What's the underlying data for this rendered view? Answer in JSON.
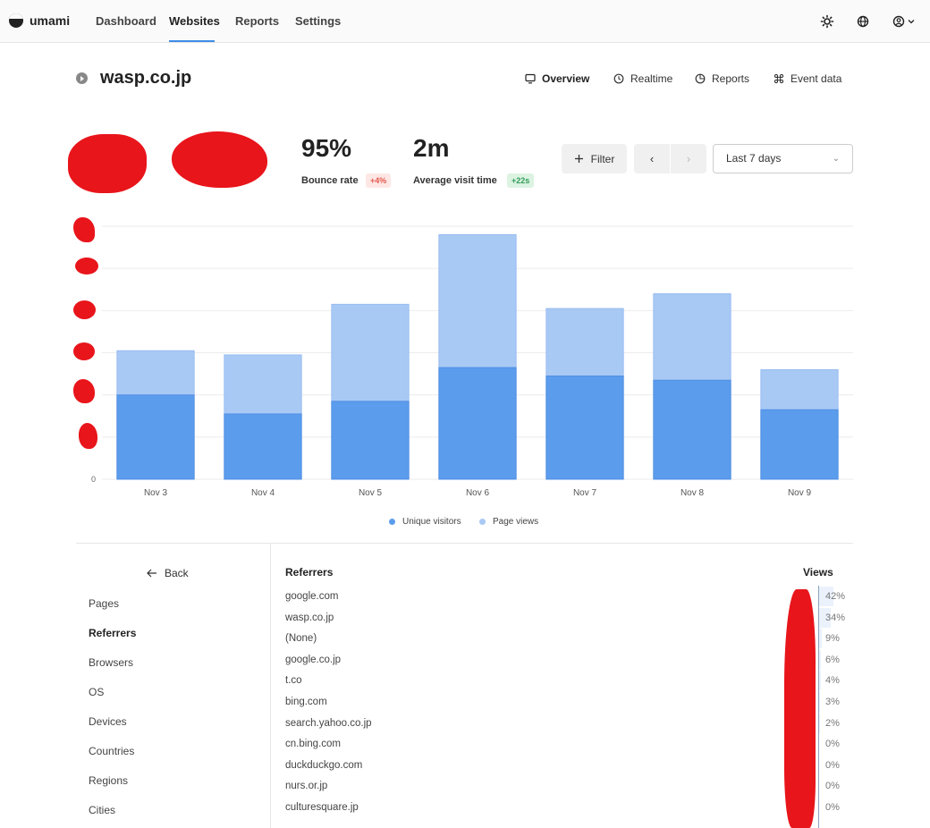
{
  "app": {
    "name": "umami"
  },
  "nav": {
    "items": [
      {
        "label": "Dashboard",
        "active": false
      },
      {
        "label": "Websites",
        "active": true
      },
      {
        "label": "Reports",
        "active": false
      },
      {
        "label": "Settings",
        "active": false
      }
    ]
  },
  "site": {
    "title": "wasp.co.jp"
  },
  "tabs": [
    {
      "label": "Overview",
      "icon": "monitor-icon",
      "active": true
    },
    {
      "label": "Realtime",
      "icon": "clock-icon",
      "active": false
    },
    {
      "label": "Reports",
      "icon": "reports-icon",
      "active": false
    },
    {
      "label": "Event data",
      "icon": "event-data-icon",
      "active": false
    }
  ],
  "metrics": {
    "bounce": {
      "value": "95%",
      "label": "Bounce rate",
      "change": "+4%"
    },
    "visit_time": {
      "value": "2m",
      "label": "Average visit time",
      "change": "+22s"
    }
  },
  "filter": {
    "label": "Filter"
  },
  "date_range": {
    "value": "Last 7 days"
  },
  "colors": {
    "unique": "#5b9cec",
    "views": "#a9c9f5",
    "accent": "#3e8ee8"
  },
  "chart_data": {
    "type": "bar",
    "categories": [
      "Nov 3",
      "Nov 4",
      "Nov 5",
      "Nov 6",
      "Nov 7",
      "Nov 8",
      "Nov 9"
    ],
    "series": [
      {
        "name": "Unique visitors",
        "values": [
          20,
          15.5,
          18.5,
          26.5,
          24.5,
          23.5,
          16.5
        ]
      },
      {
        "name": "Page views",
        "values": [
          30.5,
          29.5,
          41.5,
          58,
          40.5,
          44,
          26
        ]
      }
    ],
    "stacked": "overlay",
    "ylim": [
      0,
      60
    ],
    "y_tick_labels": [
      "0"
    ],
    "grid": true,
    "legend": "bottom-center"
  },
  "side_menu": {
    "back": "Back",
    "items": [
      {
        "label": "Pages",
        "active": false
      },
      {
        "label": "Referrers",
        "active": true
      },
      {
        "label": "Browsers",
        "active": false
      },
      {
        "label": "OS",
        "active": false
      },
      {
        "label": "Devices",
        "active": false
      },
      {
        "label": "Countries",
        "active": false
      },
      {
        "label": "Regions",
        "active": false
      },
      {
        "label": "Cities",
        "active": false
      }
    ]
  },
  "table": {
    "col_referrers": "Referrers",
    "col_views": "Views",
    "rows": [
      {
        "name": "google.com",
        "pct": "42%",
        "share": 0.42
      },
      {
        "name": "wasp.co.jp",
        "pct": "34%",
        "share": 0.34
      },
      {
        "name": "(None)",
        "pct": "9%",
        "share": 0.09
      },
      {
        "name": "google.co.jp",
        "pct": "6%",
        "share": 0.06
      },
      {
        "name": "t.co",
        "pct": "4%",
        "share": 0.04
      },
      {
        "name": "bing.com",
        "pct": "3%",
        "share": 0.03
      },
      {
        "name": "search.yahoo.co.jp",
        "pct": "2%",
        "share": 0.02
      },
      {
        "name": "cn.bing.com",
        "pct": "0%",
        "share": 0
      },
      {
        "name": "duckduckgo.com",
        "pct": "0%",
        "share": 0
      },
      {
        "name": "nurs.or.jp",
        "pct": "0%",
        "share": 0
      },
      {
        "name": "culturesquare.jp",
        "pct": "0%",
        "share": 0
      }
    ]
  }
}
